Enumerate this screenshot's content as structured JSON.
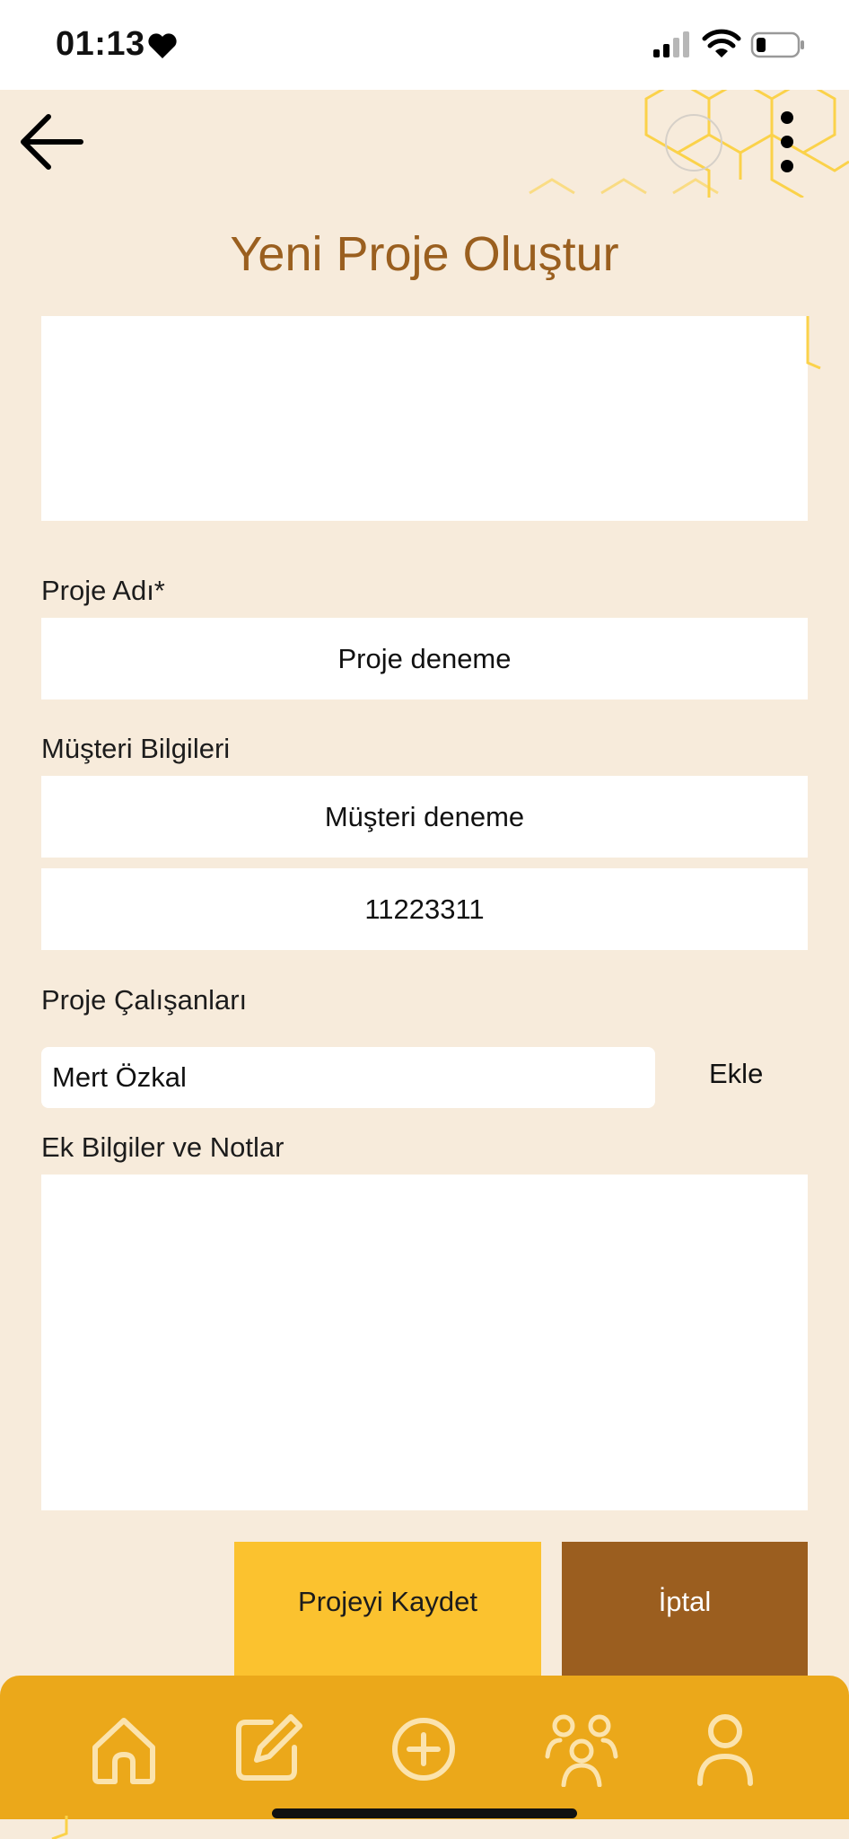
{
  "status_bar": {
    "time": "01:13",
    "icons": [
      "heart-icon",
      "cellular-signal-icon",
      "wifi-icon",
      "battery-icon"
    ]
  },
  "header": {
    "title": "Yeni Proje Oluştur",
    "back_icon": "arrow-left-icon",
    "menu_icon": "more-vertical-icon"
  },
  "form": {
    "project_name_label": "Proje Adı*",
    "project_name_value": "Proje deneme",
    "customer_label": "Müşteri Bilgileri",
    "customer_name_value": "Müşteri deneme",
    "customer_phone_value": "11223311",
    "workers_label": "Proje Çalışanları",
    "worker_value": "Mert Özkal",
    "add_label": "Ekle",
    "notes_label": "Ek Bilgiler ve Notlar",
    "notes_value": ""
  },
  "actions": {
    "save_label": "Projeyi Kaydet",
    "cancel_label": "İptal"
  },
  "bottom_nav": {
    "items": [
      "home-icon",
      "edit-icon",
      "add-circle-icon",
      "team-icon",
      "profile-icon"
    ]
  },
  "colors": {
    "background": "#f7ebdb",
    "title": "#9a5f1f",
    "save_button": "#fbc22f",
    "cancel_button": "#9b5e1f",
    "nav_bar": "#eba81a",
    "hex_accent": "#fbd24a"
  }
}
